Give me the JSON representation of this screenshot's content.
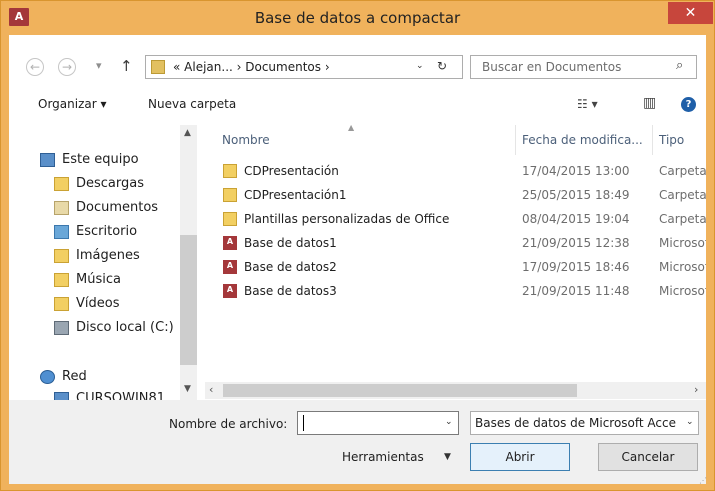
{
  "window": {
    "title": "Base de datos a compactar",
    "app_icon_text": "A",
    "close_glyph": "✕"
  },
  "nav": {
    "back_glyph": "←",
    "forward_glyph": "→",
    "history_glyph": "▾",
    "up_glyph": "↑",
    "address_path": "« Alejan...  ›  Documentos  ›",
    "address_dropdown_glyph": "⌄",
    "refresh_glyph": "↻",
    "search_placeholder": "Buscar en Documentos",
    "search_icon_glyph": "⌕"
  },
  "toolbar": {
    "organize_label": "Organizar ▾",
    "new_folder_label": "Nueva carpeta",
    "view_glyph": "☷ ▾",
    "pane_glyph": "▥",
    "help_glyph": "?"
  },
  "sidebar": {
    "items": [
      {
        "label": "Este equipo",
        "icon": "computer-icon"
      },
      {
        "label": "Descargas",
        "icon": "downloads-folder-icon"
      },
      {
        "label": "Documentos",
        "icon": "documents-folder-icon"
      },
      {
        "label": "Escritorio",
        "icon": "desktop-folder-icon"
      },
      {
        "label": "Imágenes",
        "icon": "pictures-folder-icon"
      },
      {
        "label": "Música",
        "icon": "music-folder-icon"
      },
      {
        "label": "Vídeos",
        "icon": "videos-folder-icon"
      },
      {
        "label": "Disco local (C:)",
        "icon": "local-disk-icon"
      },
      {
        "label": "Red",
        "icon": "network-icon"
      },
      {
        "label": "CURSOWIN81",
        "icon": "network-computer-icon"
      }
    ]
  },
  "file_list": {
    "columns": [
      "Nombre",
      "Fecha de modifica...",
      "Tipo"
    ],
    "rows": [
      {
        "name": "CDPresentación",
        "date": "17/04/2015 13:00",
        "type": "Carpeta d",
        "kind": "folder"
      },
      {
        "name": "CDPresentación1",
        "date": "25/05/2015 18:49",
        "type": "Carpeta d",
        "kind": "folder"
      },
      {
        "name": "Plantillas personalizadas de Office",
        "date": "08/04/2015 19:04",
        "type": "Carpeta d",
        "kind": "folder"
      },
      {
        "name": "Base de datos1",
        "date": "21/09/2015 12:38",
        "type": "Microsoft",
        "kind": "database"
      },
      {
        "name": "Base de datos2",
        "date": "17/09/2015 18:46",
        "type": "Microsoft",
        "kind": "database"
      },
      {
        "name": "Base de datos3",
        "date": "21/09/2015 11:48",
        "type": "Microsoft",
        "kind": "database"
      }
    ]
  },
  "bottom": {
    "filename_label": "Nombre de archivo:",
    "filename_value": "",
    "filetype_value": "Bases de datos de Microsoft Acce",
    "tools_label": "Herramientas",
    "open_label": "Abrir",
    "cancel_label": "Cancelar"
  },
  "colors": {
    "titlebar": "#f0b25c",
    "close_button": "#c7463c",
    "access_red": "#a4373a",
    "folder_yellow": "#f2cf62"
  }
}
